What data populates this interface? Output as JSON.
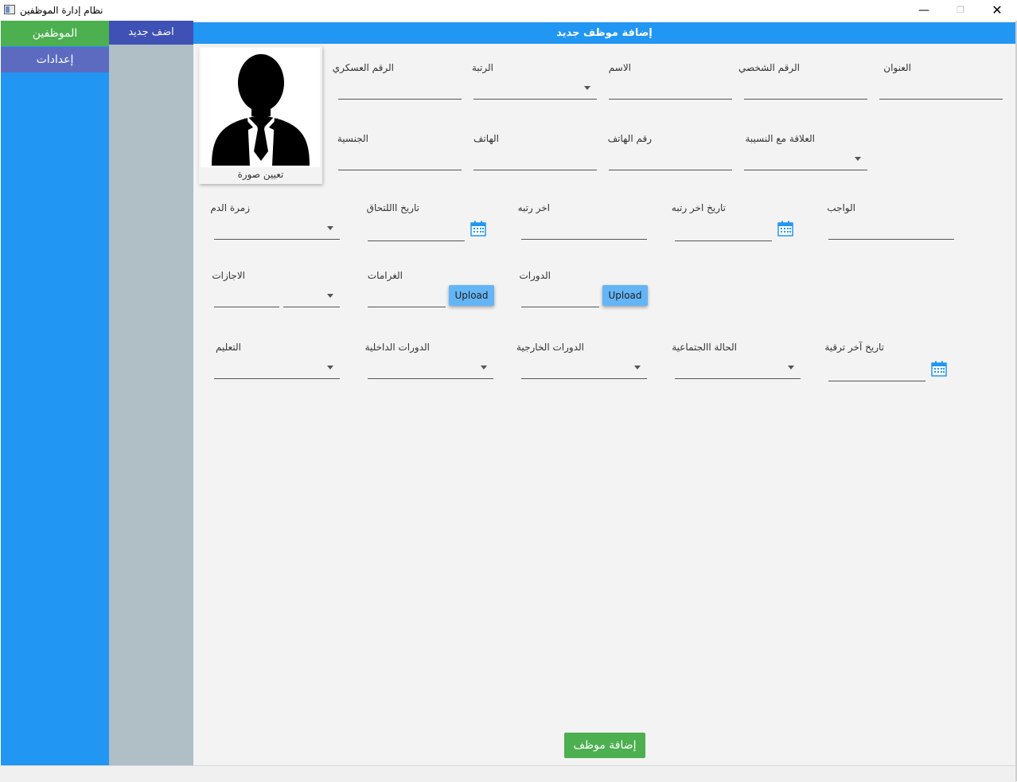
{
  "window": {
    "title": "نظام إدارة الموظفين",
    "minimize": "—",
    "maximize": "❐",
    "close": "✕"
  },
  "nav": {
    "employees": "الموظفين",
    "settings": "إعدادات"
  },
  "subnav": {
    "add_new": "اضف جديد"
  },
  "header": {
    "title": "إضافة موظف جديد"
  },
  "photo": {
    "label": "تعيين صورة"
  },
  "fields": {
    "address": "العنوان",
    "personal_no": "الرقم الشخصي",
    "name": "الاسم",
    "rank": "الرتبة",
    "military_no": "الرقم العسكري",
    "relation": "العلاقة مع النسيبة",
    "phone_no": "رقم الهاتف",
    "phone": "الهاتف",
    "nationality": "الجنسية",
    "duty": "الواجب",
    "last_rank_date": "تاريخ اخر رتبه",
    "last_rank": "اخر رتبه",
    "join_date": "تاريخ االلتحاق",
    "blood_type": "زمرة الدم",
    "courses": "الدورات",
    "fines": "الغرامات",
    "leaves": "الاجازات",
    "last_promotion_date": "تاريخ آخر ترقية",
    "social_status": "الحالة االجتماعية",
    "external_courses": "الدورات الخارجية",
    "internal_courses": "الدورات الداخلية",
    "education": "التعليم"
  },
  "buttons": {
    "upload_courses": "Upload",
    "upload_fines": "Upload",
    "submit": "إضافة موظف"
  },
  "colors": {
    "nav_blue": "#2196f3",
    "green": "#4caf50",
    "indigo": "#5c6bc0",
    "subnav_gray": "#b0bec5",
    "upload_blue": "#64b5f6"
  }
}
